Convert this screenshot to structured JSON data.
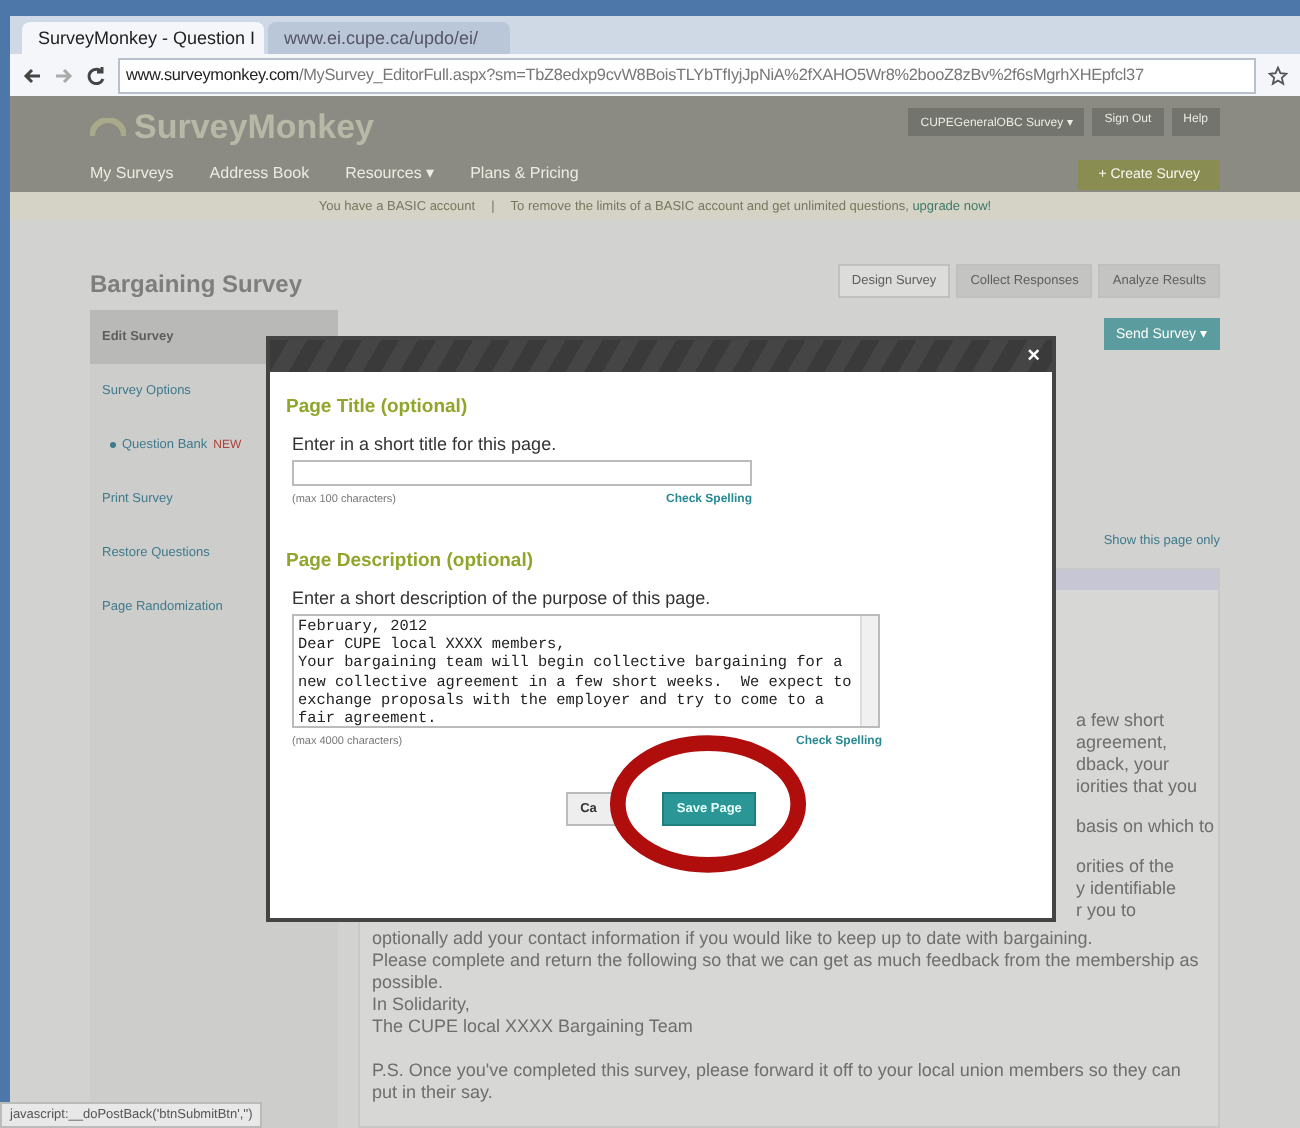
{
  "browser": {
    "tabs": [
      {
        "label": "SurveyMonkey - Question I",
        "selected": true
      },
      {
        "label": "www.ei.cupe.ca/updo/ei/",
        "selected": false
      }
    ],
    "url_host": "www.surveymonkey.com",
    "url_path": "/MySurvey_EditorFull.aspx?sm=TbZ8edxp9cvW8BoisTLYbTfIyjJpNiA%2fXAHO5Wr8%2booZ8zBv%2f6sMgrhXHEpfcl37"
  },
  "header": {
    "logo": "SurveyMonkey",
    "nav": [
      "My Surveys",
      "Address Book",
      "Resources ▾",
      "Plans & Pricing"
    ],
    "account_menu": "CUPEGeneralOBC Survey ▾",
    "links": [
      "Sign Out",
      "Help"
    ],
    "create_button": "+ Create Survey"
  },
  "banner": {
    "text": "You have a BASIC account",
    "separator": "|",
    "message": "To remove the limits of a BASIC account and get unlimited questions,",
    "link": "upgrade now!"
  },
  "survey": {
    "title": "Bargaining Survey",
    "tabs": [
      {
        "label": "Design Survey",
        "selected": true
      },
      {
        "label": "Collect Responses",
        "selected": false
      },
      {
        "label": "Analyze Results",
        "selected": false
      }
    ],
    "send_button": "Send Survey ▾",
    "sidebar": [
      {
        "label": "Edit Survey",
        "kind": "plain",
        "selected": true
      },
      {
        "label": "Survey Options",
        "kind": "link",
        "selected": false
      },
      {
        "label": "Question Bank",
        "kind": "sub",
        "badge": "NEW",
        "selected": false
      },
      {
        "label": "Print Survey",
        "kind": "link",
        "selected": false
      },
      {
        "label": "Restore Questions",
        "kind": "link",
        "selected": false
      },
      {
        "label": "Page Randomization",
        "kind": "link",
        "selected": false
      }
    ],
    "page_link": "Show this page only",
    "body_fragments": [
      [
        "a few short",
        "agreement,",
        "dback, your",
        "iorities that you"
      ],
      [
        "basis on which to"
      ],
      [
        "orities of the",
        "y identifiable",
        "r you to"
      ]
    ],
    "body_lines": [
      [
        "optionally add your contact information if you would like to keep up to date with bargaining.",
        "Please complete and return the following so that we can get as much feedback from the membership as possible.",
        "In Solidarity,",
        "The CUPE local XXXX Bargaining Team"
      ],
      [
        "P.S. Once you've completed this survey, please forward it off to your local union members so they can put in their say."
      ]
    ]
  },
  "dialog": {
    "close": "×",
    "title_heading": "Page Title (optional)",
    "title_prompt": "Enter in a short title for this page.",
    "title_limit": "(max 100 characters)",
    "title_spell": "Check Spelling",
    "desc_heading": "Page Description (optional)",
    "desc_prompt": "Enter a short description of the purpose of this page.",
    "desc_value": "February, 2012\nDear CUPE local XXXX members,\nYour bargaining team will begin collective bargaining for a new collective agreement in a few short weeks.  We expect to exchange proposals with the employer and try to come to a fair agreement.",
    "desc_limit": "(max 4000 characters)",
    "desc_spell": "Check Spelling",
    "buttons": [
      {
        "label": "Ca",
        "kind": "secondary"
      },
      {
        "label": "Save Page",
        "kind": "primary"
      }
    ]
  },
  "status_bar": "javascript:__doPostBack('btnSubmitBtn','')"
}
